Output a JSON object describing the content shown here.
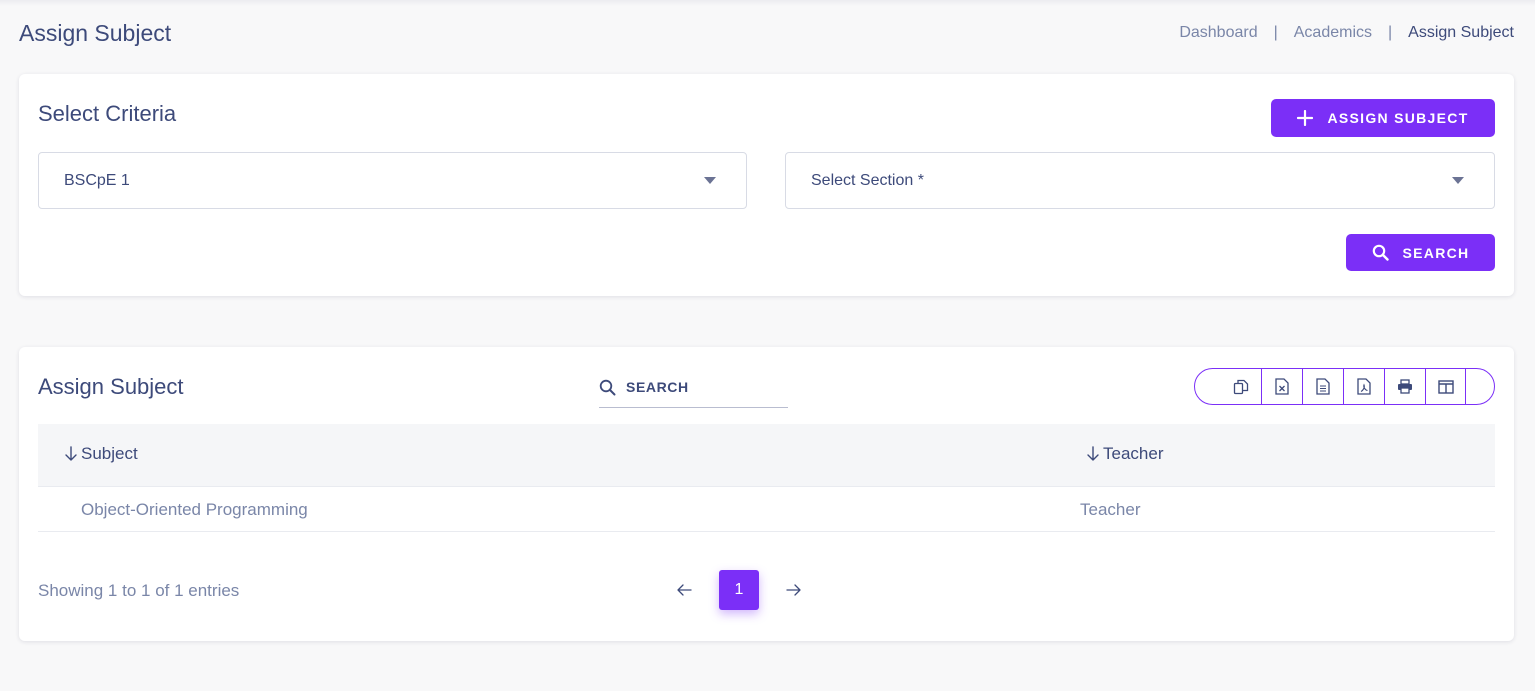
{
  "header": {
    "title": "Assign Subject",
    "breadcrumb": [
      "Dashboard",
      "Academics",
      "Assign Subject"
    ],
    "separator": "|"
  },
  "criteria": {
    "title": "Select Criteria",
    "assign_button_label": "ASSIGN SUBJECT",
    "class_select_value": "BSCpE 1",
    "section_select_placeholder": "Select Section *",
    "search_button_label": "SEARCH"
  },
  "list": {
    "title": "Assign Subject",
    "search_placeholder": "SEARCH",
    "export_icons": [
      "copy-icon",
      "excel-icon",
      "csv-icon",
      "pdf-icon",
      "print-icon",
      "columns-icon"
    ],
    "columns": [
      "Subject",
      "Teacher"
    ],
    "rows": [
      {
        "subject": "Object-Oriented Programming",
        "teacher": "Teacher"
      }
    ],
    "showing_text": "Showing 1 to 1 of 1 entries",
    "current_page": "1"
  },
  "colors": {
    "accent": "#7b2ff7",
    "text_primary": "#3d4a7a",
    "text_muted": "#7a86a8",
    "background": "#f8f8f9"
  }
}
